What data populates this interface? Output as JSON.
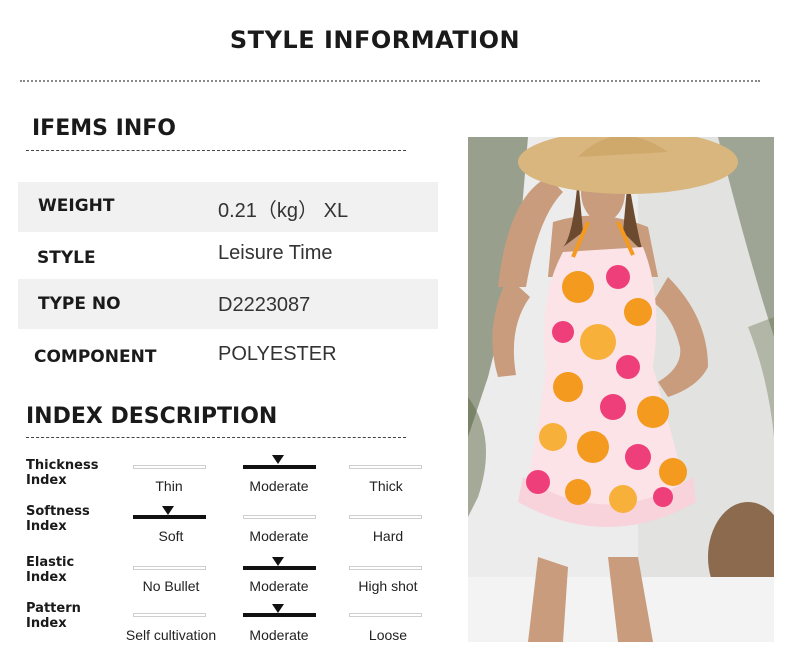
{
  "title": "STYLE INFORMATION",
  "items_info": {
    "heading": "IFEMS INFO",
    "rows": [
      {
        "label": "WEIGHT",
        "value": "0.21（kg） XL"
      },
      {
        "label": "STYLE",
        "value": "Leisure Time"
      },
      {
        "label": "TYPE NO",
        "value": "D2223087"
      },
      {
        "label": "COMPONENT",
        "value": "POLYESTER"
      }
    ]
  },
  "index_description": {
    "heading": "INDEX DESCRIPTION",
    "rows": [
      {
        "label_line1": "Thickness",
        "label_line2": "Index",
        "options": [
          "Thin",
          "Moderate",
          "Thick"
        ],
        "selected_index": 1
      },
      {
        "label_line1": "Softness",
        "label_line2": "Index",
        "options": [
          "Soft",
          "Moderate",
          "Hard"
        ],
        "selected_index": 0
      },
      {
        "label_line1": "Elastic",
        "label_line2": "Index",
        "options": [
          "No Bullet",
          "Moderate",
          "High shot"
        ],
        "selected_index": 1
      },
      {
        "label_line1": "Pattern",
        "label_line2": "Index",
        "options": [
          "Self cultivation",
          "Moderate",
          "Loose"
        ],
        "selected_index": 1
      }
    ]
  },
  "colors": {
    "dress_orange": "#f39a1f",
    "dress_pink": "#ef3f7a",
    "dress_light": "#fbe3e8",
    "hat": "#d9b67e"
  }
}
